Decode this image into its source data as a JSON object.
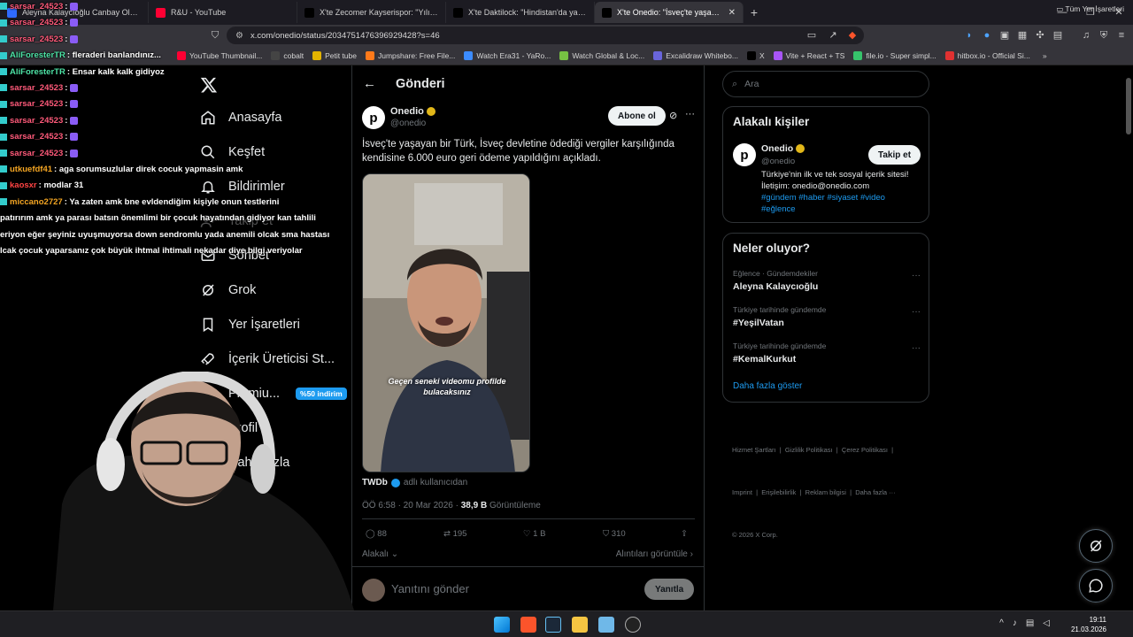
{
  "browser": {
    "tabs": [
      {
        "label": "Aleyna Kalaycıoğlu Canbay Olayı - KO",
        "fav": "#2f6bff",
        "active": false
      },
      {
        "label": "R&U - YouTube",
        "fav": "#ff0033",
        "active": false
      },
      {
        "label": "X'te Zecomer Kayserispor: \"Yılın e",
        "fav": "#000000",
        "active": false
      },
      {
        "label": "X'te Daktilock: \"Hindistan'da yalnızca",
        "fav": "#000000",
        "active": false
      },
      {
        "label": "X'te Onedio: \"İsveç'te yaşayan",
        "fav": "#000000",
        "active": true
      }
    ],
    "url": "x.com/onedio/status/2034751476396929428?s=46",
    "bookmarks": [
      {
        "label": "YouTube Thumbnail...",
        "color": "#ff0033"
      },
      {
        "label": "cobalt",
        "color": "#444444"
      },
      {
        "label": "Petit tube",
        "color": "#e4b400"
      },
      {
        "label": "Jumpshare: Free File...",
        "color": "#ff7a1a"
      },
      {
        "label": "Watch Era31 - YaRo...",
        "color": "#3c8cff"
      },
      {
        "label": "Watch Global & Loc...",
        "color": "#76c043"
      },
      {
        "label": "Excalidraw Whitebo...",
        "color": "#6965db"
      },
      {
        "label": "X",
        "color": "#000000"
      },
      {
        "label": "Vite + React + TS",
        "color": "#a855f7"
      },
      {
        "label": "file.io - Super simpl...",
        "color": "#36c36b"
      },
      {
        "label": "hitbox.io - Official Si...",
        "color": "#e03131"
      }
    ],
    "bookmarks_all": "Tüm Yer İşaretleri"
  },
  "nav": {
    "home": "Anasayfa",
    "explore": "Keşfet",
    "notifications": "Bildirimler",
    "follow": "Takip et",
    "chat": "Sohbet",
    "grok": "Grok",
    "bookmarks": "Yer İşaretleri",
    "creator": "İçerik Üreticisi St...",
    "premium": "Premiu...",
    "premium_badge": "%50 indirim",
    "profile": "Profil",
    "more": "Daha fazla",
    "post_button": "nla"
  },
  "post": {
    "header_title": "Gönderi",
    "author_name": "Onedio",
    "author_handle": "@onedio",
    "subscribe": "Abone ol",
    "text": "İsveç'te yaşayan bir Türk, İsveç devletine ödediği vergiler karşılığında kendisine 6.000 euro geri ödeme yapıldığını açıkladı.",
    "video_caption": "Geçen seneki videomu profilde bulacaksınız",
    "source_name": "TWDb",
    "source_suffix": "adlı kullanıcıdan",
    "time": "ÖÖ 6:58 · 20 Mar 2026 ·",
    "views_count": "38,9 B",
    "views_label": "Görüntüleme",
    "replies": "88",
    "reposts": "195",
    "likes": "1 B",
    "bookmarks": "310",
    "relevant": "Alakalı",
    "quotes": "Alıntıları görüntüle",
    "reply_placeholder": "Yanıtını gönder",
    "reply_button": "Yanıtla"
  },
  "sidebar": {
    "search_placeholder": "Ara",
    "people_title": "Alakalı kişiler",
    "person_name": "Onedio",
    "person_handle": "@onedio",
    "follow_button": "Takip et",
    "bio": "Türkiye'nin ilk ve tek sosyal içerik sitesi! İletişim: onedio@onedio.com",
    "bio_tags": "#gündem #haber #siyaset #video #eğlence",
    "trends_title": "Neler oluyor?",
    "trends": [
      {
        "context": "Eğlence · Gündemdekiler",
        "name": "Aleyna Kalaycıoğlu"
      },
      {
        "context": "Türkiye tarihinde gündemde",
        "name": "#YeşilVatan"
      },
      {
        "context": "Türkiye tarihinde gündemde",
        "name": "#KemalKurkut"
      }
    ],
    "show_more": "Daha fazla göster",
    "footer_1": "Hizmet Şartları  |  Gizlilik Politikası  |  Çerez Politikası  |",
    "footer_2": "Imprint  |  Erişilebilirlik  |  Reklam bilgisi  |  Daha fazla ···",
    "footer_3": "© 2026 X Corp."
  },
  "chat": [
    {
      "user": "sarsar_24523",
      "msg": "",
      "color": "#ff5a7a"
    },
    {
      "user": "sarsar_24523",
      "msg": "",
      "color": "#ff5a7a"
    },
    {
      "user": "sarsar_24523",
      "msg": "",
      "color": "#ff5a7a"
    },
    {
      "user": "AliForesterTR",
      "msg": "fleraderi banlandınız...",
      "color": "#4de3a6"
    },
    {
      "user": "AliForesterTR",
      "msg": "Ensar kalk kalk gidiyoz",
      "color": "#4de3a6"
    },
    {
      "user": "sarsar_24523",
      "msg": "",
      "color": "#ff5a7a"
    },
    {
      "user": "sarsar_24523",
      "msg": "",
      "color": "#ff5a7a"
    },
    {
      "user": "sarsar_24523",
      "msg": "",
      "color": "#ff5a7a"
    },
    {
      "user": "sarsar_24523",
      "msg": "",
      "color": "#ff5a7a"
    },
    {
      "user": "sarsar_24523",
      "msg": "",
      "color": "#ff5a7a"
    },
    {
      "user": "utkuefdf41",
      "msg": "aga sorumsuzlular direk cocuk yapmasin amk",
      "color": "#f5a623"
    },
    {
      "user": "kaosxr",
      "msg": "modlar 31",
      "color": "#ff4444"
    },
    {
      "user": "miccano2727",
      "msg": "Ya zaten amk bne evldendiğim kişiyle onun testlerini",
      "color": "#f5a623"
    },
    {
      "user": "",
      "msg": "patırırım amk ya parası batsın önemlimi bir çocuk hayatından gidiyor kan tahlili",
      "color": "#ffffff"
    },
    {
      "user": "",
      "msg": "eriyon eğer şeyiniz uyuşmuyorsa down sendromlu yada anemili olcak sma hastası",
      "color": "#ffffff"
    },
    {
      "user": "",
      "msg": "lcak çocuk yaparsanız çok büyük ihtmal ihtimali nekadar diye bilgi veriyolar",
      "color": "#ffffff"
    }
  ],
  "taskbar": {
    "time": "19:11",
    "date": "21.03.2026"
  }
}
